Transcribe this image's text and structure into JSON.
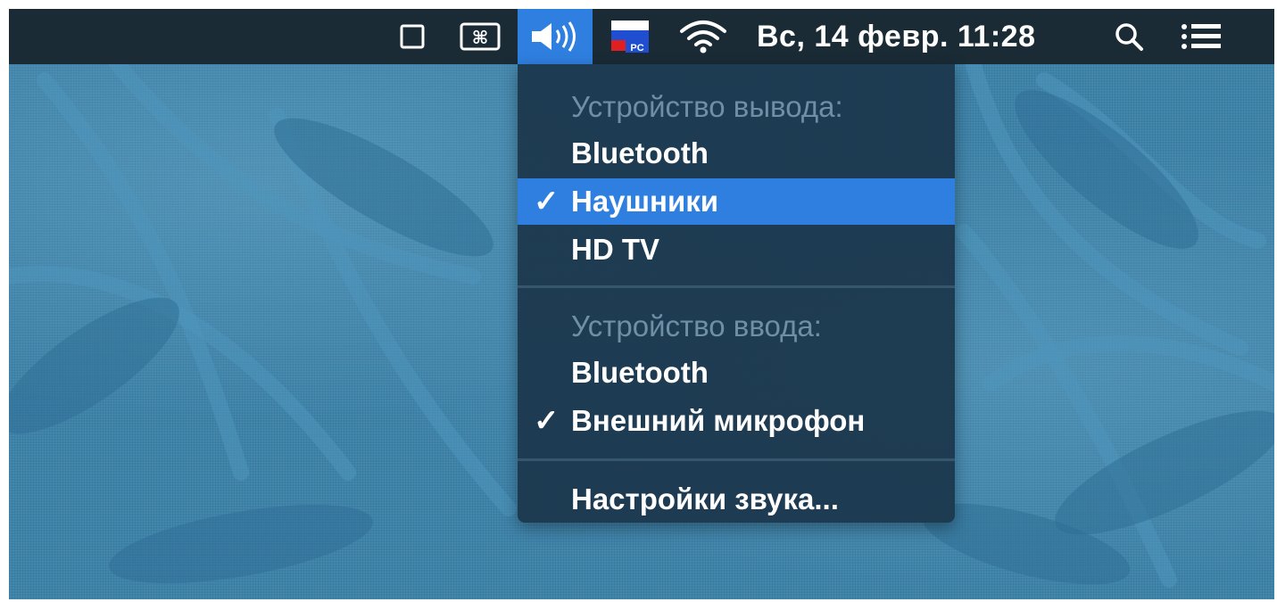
{
  "menubar": {
    "icons": [
      "window-icon",
      "command-icon",
      "volume-icon",
      "flag-icon",
      "wifi-icon",
      "search-icon",
      "list-icon"
    ],
    "flag_label": "PC",
    "clock": "Вс, 14 февр. 11:28"
  },
  "menu": {
    "output_header": "Устройство вывода:",
    "output_items": [
      {
        "label": "Bluetooth",
        "checked": false
      },
      {
        "label": "Наушники",
        "checked": true
      },
      {
        "label": "HD TV",
        "checked": false
      }
    ],
    "input_header": "Устройство ввода:",
    "input_items": [
      {
        "label": "Bluetooth",
        "checked": false
      },
      {
        "label": "Внешний микрофон",
        "checked": true
      }
    ],
    "settings_label": "Настройки звука...",
    "check_mark": "✓"
  },
  "colors": {
    "menubar_bg": "#1a2b36",
    "accent": "#2f7fe0",
    "menu_bg": "#1c384e",
    "header_text": "#6f8fa6",
    "wallpaper": "#3d82a9"
  }
}
